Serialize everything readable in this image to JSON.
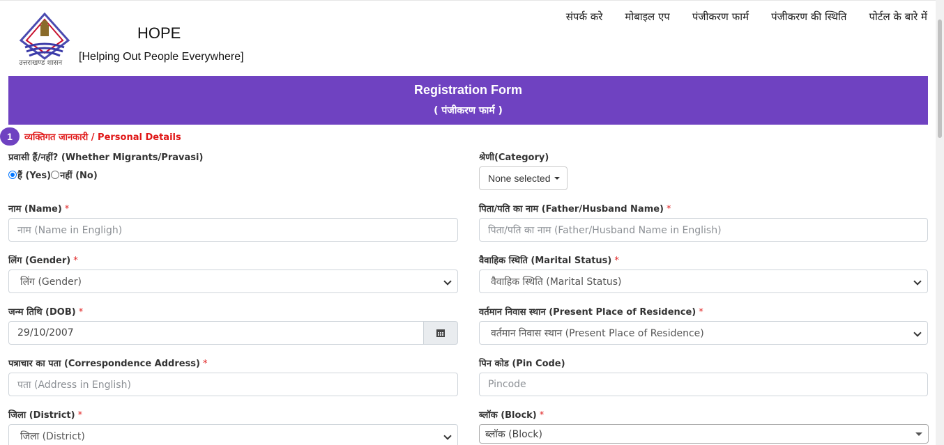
{
  "header": {
    "logo_caption": "उत्तराखण्ड शासन",
    "title": "HOPE",
    "subtitle": "[Helping Out People Everywhere]",
    "nav": [
      "संपर्क करे",
      "मोबाइल एप",
      "पंजीकरण फार्म",
      "पंजीकरण की स्थिति",
      "पोर्टल के बारे में"
    ]
  },
  "banner": {
    "title": "Registration Form",
    "subtitle": "( पंजीकरण फार्म )"
  },
  "section": {
    "number": "1",
    "title": "व्यक्तिगत जानकारी / Personal Details"
  },
  "form": {
    "migrant": {
      "label": "प्रवासी हैं/नहीं? (Whether Migrants/Pravasi)",
      "yes": "हैं (Yes)",
      "no": "नहीं (No)",
      "selected": "yes"
    },
    "category": {
      "label": "श्रेणी(Category)",
      "button": "None selected"
    },
    "name": {
      "label": "नाम (Name)",
      "required": "*",
      "placeholder": "नाम (Name in Engligh)"
    },
    "father": {
      "label": "पिता/पति का नाम (Father/Husband Name)",
      "required": "*",
      "placeholder": "पिता/पति का नाम (Father/Husband Name in English)"
    },
    "gender": {
      "label": "लिंग (Gender)",
      "required": "*",
      "selected": "लिंग (Gender)"
    },
    "marital": {
      "label": "वैवाहिक स्थिति (Marital Status)",
      "required": "*",
      "selected": "वैवाहिक स्थिति (Marital Status)"
    },
    "dob": {
      "label": "जन्म तिथि (DOB)",
      "required": "*",
      "value": "29/10/2007"
    },
    "residence": {
      "label": "वर्तमान निवास स्थान (Present Place of Residence)",
      "required": "*",
      "selected": "वर्तमान निवास स्थान (Present Place of Residence)"
    },
    "address": {
      "label": "पत्राचार का पता (Correspondence Address)",
      "required": "*",
      "placeholder": "पता (Address in English)"
    },
    "pincode": {
      "label": "पिन कोड (Pin Code)",
      "placeholder": "Pincode"
    },
    "district": {
      "label": "जिला (District)",
      "required": "*",
      "selected": "जिला (District)"
    },
    "block": {
      "label": "ब्लॉक (Block)",
      "required": "*",
      "selected": "ब्लॉक (Block)"
    }
  },
  "colors": {
    "banner": "#6f42c1",
    "required": "#e02424",
    "section_title": "#e01616"
  }
}
